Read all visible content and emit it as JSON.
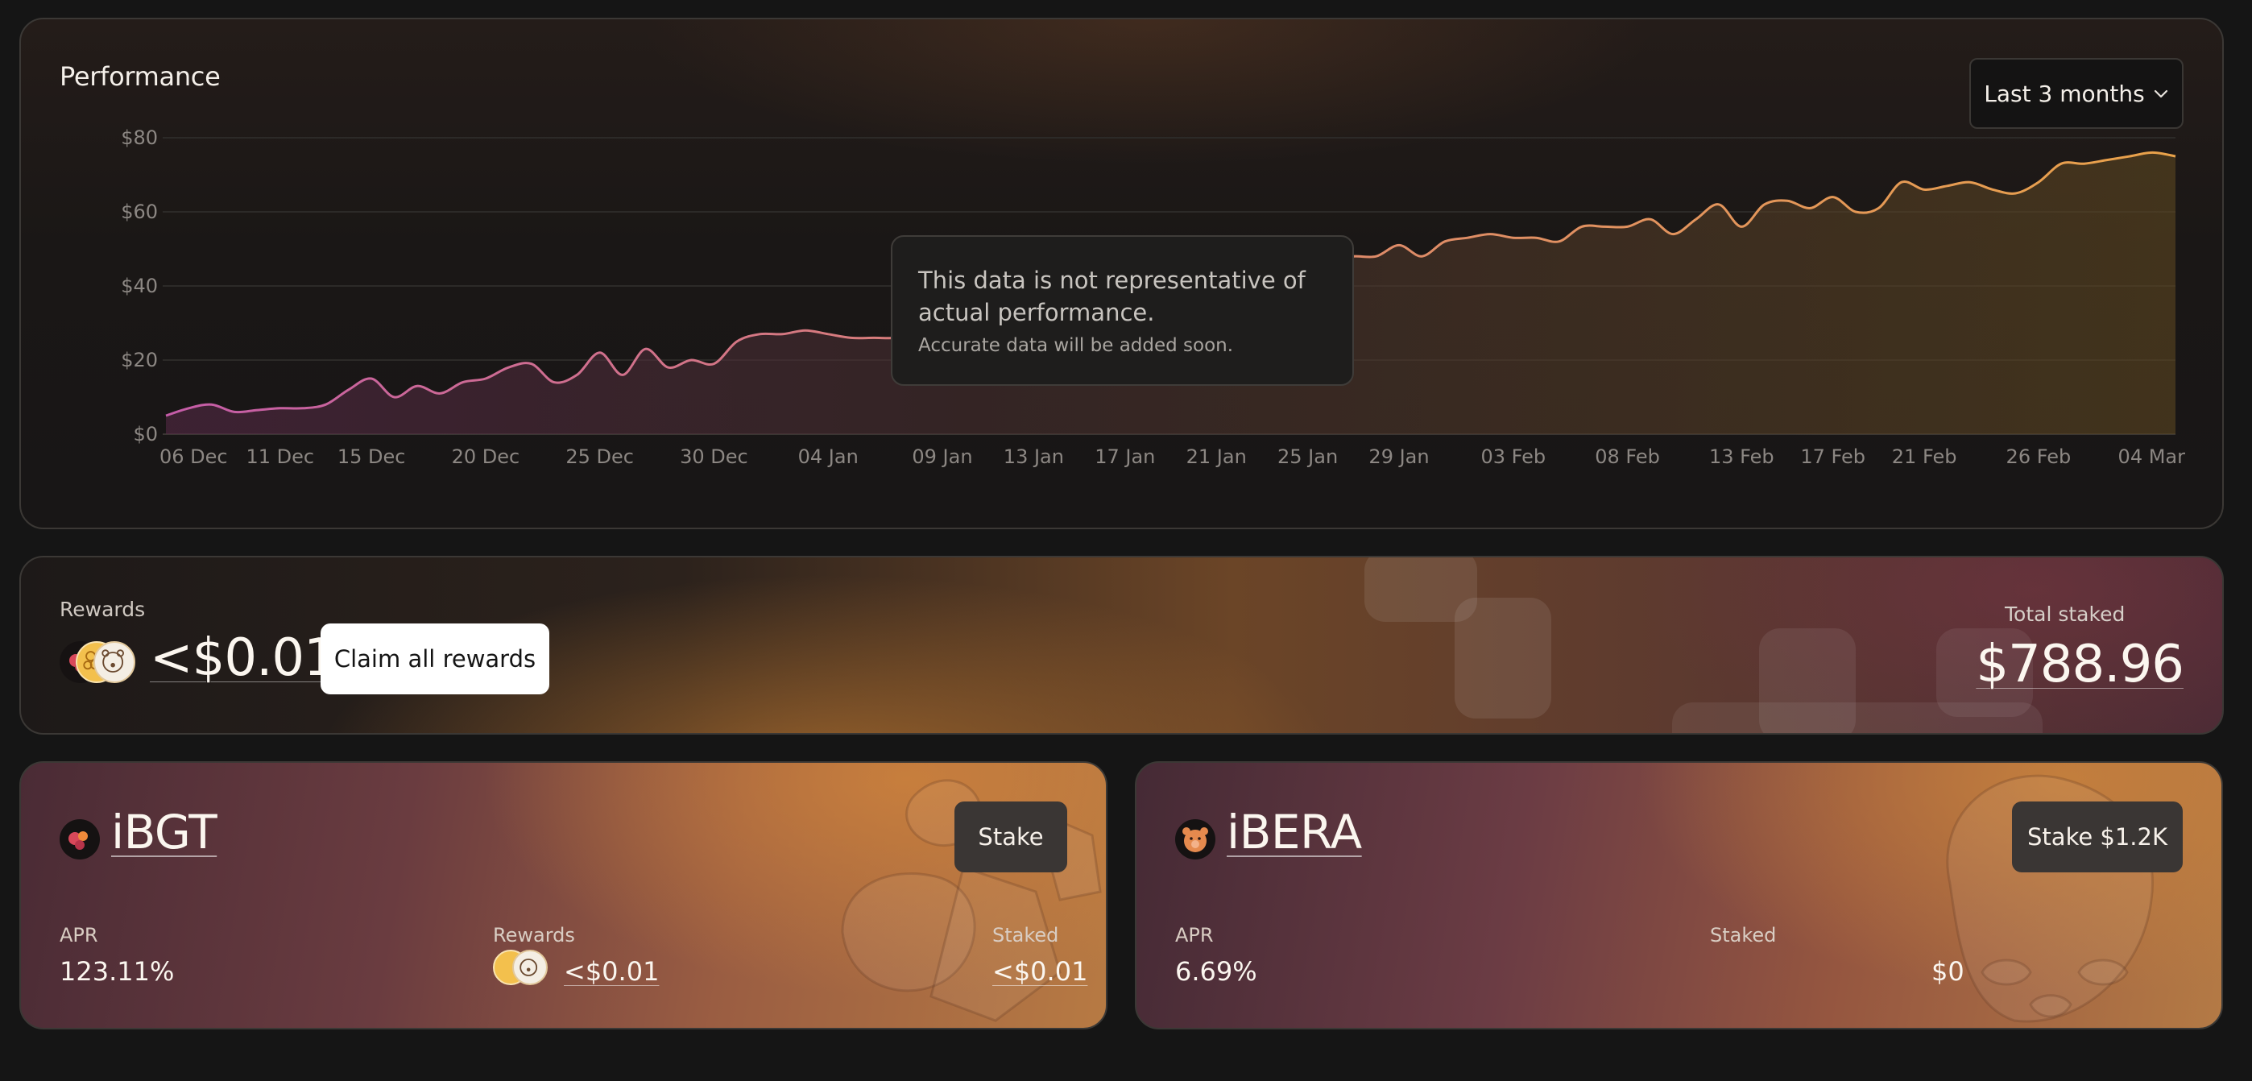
{
  "performance": {
    "title": "Performance",
    "range_label": "Last 3 months",
    "tooltip": {
      "line1": "This data is not representative of actual performance.",
      "line2": "Accurate data will be added soon."
    }
  },
  "chart_data": {
    "type": "area",
    "x_ticks": [
      "06 Dec",
      "11 Dec",
      "15 Dec",
      "20 Dec",
      "25 Dec",
      "30 Dec",
      "04 Jan",
      "09 Jan",
      "13 Jan",
      "17 Jan",
      "21 Jan",
      "25 Jan",
      "29 Jan",
      "03 Feb",
      "08 Feb",
      "13 Feb",
      "17 Feb",
      "21 Feb",
      "26 Feb",
      "04 Mar"
    ],
    "y_ticks": [
      "$0",
      "$20",
      "$40",
      "$60",
      "$80"
    ],
    "ylim": [
      0,
      80
    ],
    "x": [
      "06 Dec",
      "07 Dec",
      "08 Dec",
      "09 Dec",
      "10 Dec",
      "11 Dec",
      "12 Dec",
      "13 Dec",
      "14 Dec",
      "15 Dec",
      "16 Dec",
      "17 Dec",
      "18 Dec",
      "19 Dec",
      "20 Dec",
      "21 Dec",
      "22 Dec",
      "23 Dec",
      "24 Dec",
      "25 Dec",
      "26 Dec",
      "27 Dec",
      "28 Dec",
      "29 Dec",
      "30 Dec",
      "31 Dec",
      "01 Jan",
      "02 Jan",
      "03 Jan",
      "04 Jan",
      "05 Jan",
      "06 Jan",
      "07 Jan",
      "08 Jan",
      "09 Jan",
      "10 Jan",
      "11 Jan",
      "12 Jan",
      "13 Jan",
      "14 Jan",
      "15 Jan",
      "16 Jan",
      "17 Jan",
      "18 Jan",
      "19 Jan",
      "20 Jan",
      "21 Jan",
      "22 Jan",
      "23 Jan",
      "24 Jan",
      "25 Jan",
      "26 Jan",
      "27 Jan",
      "28 Jan",
      "29 Jan",
      "30 Jan",
      "31 Jan",
      "01 Feb",
      "02 Feb",
      "03 Feb",
      "04 Feb",
      "05 Feb",
      "06 Feb",
      "07 Feb",
      "08 Feb",
      "09 Feb",
      "10 Feb",
      "11 Feb",
      "12 Feb",
      "13 Feb",
      "14 Feb",
      "15 Feb",
      "16 Feb",
      "17 Feb",
      "18 Feb",
      "19 Feb",
      "20 Feb",
      "21 Feb",
      "22 Feb",
      "23 Feb",
      "24 Feb",
      "25 Feb",
      "26 Feb",
      "27 Feb",
      "28 Feb",
      "01 Mar",
      "02 Mar",
      "03 Mar",
      "04 Mar"
    ],
    "values": [
      5,
      7,
      8,
      6,
      6.5,
      7,
      7,
      8,
      12,
      15,
      10,
      13,
      11,
      14,
      15,
      18,
      19,
      14,
      16,
      22,
      16,
      23,
      18,
      20,
      19,
      25,
      27,
      27,
      28,
      27,
      26,
      26,
      26,
      27,
      28,
      30,
      31,
      31,
      32,
      33,
      34,
      35,
      35,
      36,
      38,
      39,
      40,
      42,
      43,
      44,
      46,
      47,
      48,
      48,
      51,
      48,
      52,
      53,
      54,
      53,
      53,
      52,
      56,
      56,
      56,
      58,
      54,
      58,
      62,
      56,
      62,
      63,
      61,
      64,
      60,
      61,
      68,
      66,
      67,
      68,
      66,
      65,
      68,
      73,
      73,
      74,
      75,
      76,
      75
    ],
    "ylabel": "",
    "xlabel": "",
    "grid": true,
    "colors": {
      "line_start": "#c55ca8",
      "line_end": "#e9a24a"
    }
  },
  "rewards": {
    "label": "Rewards",
    "amount": "<$0.01",
    "claim_label": "Claim all rewards",
    "total_label": "Total staked",
    "total_value": "$788.96",
    "token_icons": [
      "ibgt-token-icon",
      "honey-token-icon",
      "bear-token-icon"
    ]
  },
  "vaults": [
    {
      "name": "iBGT",
      "stake_label": "Stake",
      "apr_label": "APR",
      "apr_value": "123.11%",
      "rewards_label": "Rewards",
      "rewards_value": "<$0.01",
      "staked_label": "Staked",
      "staked_value": "<$0.01"
    },
    {
      "name": "iBERA",
      "stake_label": "Stake $1.2K",
      "apr_label": "APR",
      "apr_value": "6.69%",
      "staked_label": "Staked",
      "staked_value": "$0"
    }
  ]
}
